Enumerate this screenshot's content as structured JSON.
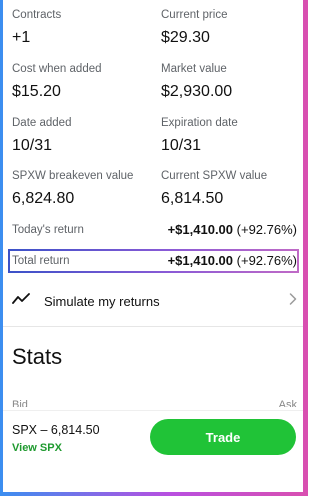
{
  "details": [
    {
      "label": "Contracts",
      "value": "+1"
    },
    {
      "label": "Current price",
      "value": "$29.30"
    },
    {
      "label": "Cost when added",
      "value": "$15.20"
    },
    {
      "label": "Market value",
      "value": "$2,930.00"
    },
    {
      "label": "Date added",
      "value": "10/31"
    },
    {
      "label": "Expiration date",
      "value": "10/31"
    },
    {
      "label": "SPXW breakeven value",
      "value": "6,824.80"
    },
    {
      "label": "Current SPXW value",
      "value": "6,814.50"
    }
  ],
  "todays_return": {
    "label": "Today's return",
    "amount": "+$1,410.00",
    "pct": "(+92.76%)"
  },
  "total_return": {
    "label": "Total return",
    "amount": "+$1,410.00",
    "pct": "(+92.76%)"
  },
  "simulate": {
    "label": "Simulate my returns",
    "icon": "trend-line-icon",
    "chevron": "chevron-right-icon"
  },
  "stats": {
    "heading": "Stats"
  },
  "bottom": {
    "symbol": "SPX – 6,814.50",
    "view_link": "View SPX",
    "trade_button": "Trade"
  },
  "colors": {
    "accent_green": "#20c337",
    "link_green": "#1f9a2f",
    "highlight_border": "#3b52c8"
  }
}
